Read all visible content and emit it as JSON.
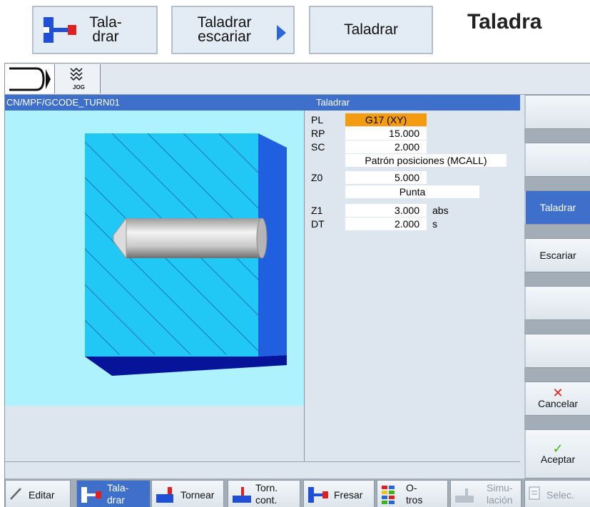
{
  "breadcrumb": {
    "item1_line1": "Tala-",
    "item1_line2": "drar",
    "item2_line1": "Taladrar",
    "item2_line2": "escariar",
    "item3": "Taladrar"
  },
  "page_heading": "Taladra",
  "toolbar": {
    "mode_icon": "channel-icon",
    "jog_label": "JOG"
  },
  "header": {
    "path": "CN/MPF/GCODE_TURN01",
    "form_title": "Taladrar"
  },
  "params": [
    {
      "label": "PL",
      "value": "G17 (XY)",
      "unit": ""
    },
    {
      "label": "RP",
      "value": "15.000",
      "unit": ""
    },
    {
      "label": "SC",
      "value": "2.000",
      "unit": ""
    },
    {
      "label": "",
      "value": "Patrón posiciones (MCALL)",
      "unit": ""
    },
    {
      "label": "Z0",
      "value": "5.000",
      "unit": ""
    },
    {
      "label": "",
      "value": "Punta",
      "unit": ""
    },
    {
      "label": "Z1",
      "value": "3.000",
      "unit": "abs"
    },
    {
      "label": "DT",
      "value": "2.000",
      "unit": "s"
    }
  ],
  "softkeys_right": {
    "k3": "Taladrar",
    "k4": "Escariar",
    "k7": "Cancelar",
    "k8": "Aceptar"
  },
  "softkeys_bottom": {
    "editar": "Editar",
    "taladrar_l1": "Tala-",
    "taladrar_l2": "drar",
    "tornear": "Tornear",
    "torn_l1": "Torn.",
    "torn_l2": "cont.",
    "fresar": "Fresar",
    "otros_l1": "O-",
    "otros_l2": "tros",
    "sim_l1": "Simu-",
    "sim_l2": "lación",
    "selec": "Selec."
  },
  "colors": {
    "active_blue": "#3d6fcb",
    "highlight_orange": "#f39c12",
    "workpiece_cyan": "#21c8f6"
  }
}
